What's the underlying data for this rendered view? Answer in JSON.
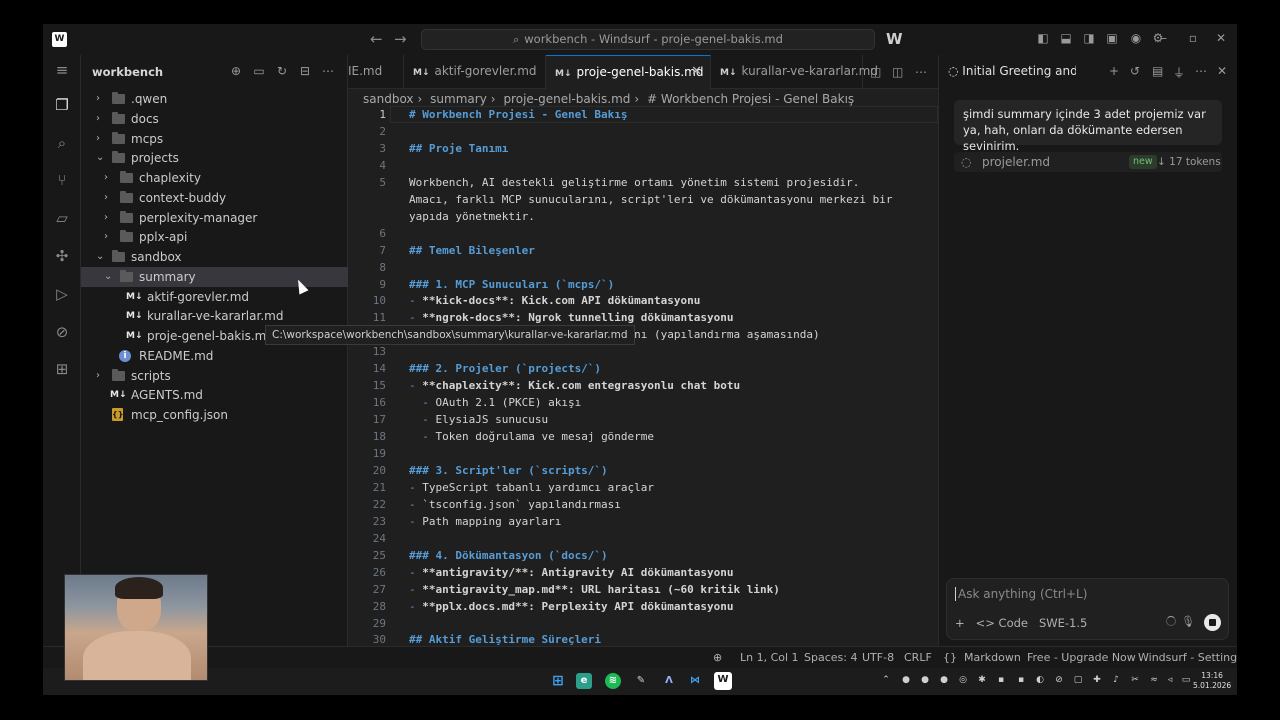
{
  "window": {
    "title": "workbench - Windsurf - proje-genel-bakis.md"
  },
  "sidebar": {
    "title": "workbench",
    "tree": [
      {
        "label": ".qwen",
        "kind": "folder",
        "state": "collapsed",
        "depth": 0
      },
      {
        "label": "docs",
        "kind": "folder",
        "state": "collapsed",
        "depth": 0
      },
      {
        "label": "mcps",
        "kind": "folder",
        "state": "collapsed",
        "depth": 0
      },
      {
        "label": "projects",
        "kind": "folder",
        "state": "expanded",
        "depth": 0
      },
      {
        "label": "chaplexity",
        "kind": "folder",
        "state": "collapsed",
        "depth": 1
      },
      {
        "label": "context-buddy",
        "kind": "folder",
        "state": "collapsed",
        "depth": 1
      },
      {
        "label": "perplexity-manager",
        "kind": "folder",
        "state": "collapsed",
        "depth": 1
      },
      {
        "label": "pplx-api",
        "kind": "folder",
        "state": "collapsed",
        "depth": 1
      },
      {
        "label": "sandbox",
        "kind": "folder",
        "state": "expanded",
        "depth": 0
      },
      {
        "label": "summary",
        "kind": "folder",
        "state": "expanded",
        "depth": 1
      },
      {
        "label": "aktif-gorevler.md",
        "kind": "md",
        "depth": 2
      },
      {
        "label": "kurallar-ve-kararlar.md",
        "kind": "md",
        "depth": 2
      },
      {
        "label": "proje-genel-bakis.md",
        "kind": "md",
        "depth": 2
      },
      {
        "label": "README.md",
        "kind": "info",
        "depth": 1
      },
      {
        "label": "scripts",
        "kind": "folder",
        "state": "collapsed",
        "depth": 0
      },
      {
        "label": "AGENTS.md",
        "kind": "md",
        "depth": 0
      },
      {
        "label": "mcp_config.json",
        "kind": "json",
        "depth": 0
      }
    ],
    "tooltip": "C:\\workspace\\workbench\\sandbox\\summary\\kurallar-ve-kararlar.md"
  },
  "editor": {
    "tabs": [
      {
        "label": "IE.md",
        "active": false
      },
      {
        "label": "aktif-gorevler.md",
        "active": false
      },
      {
        "label": "proje-genel-bakis.md",
        "active": true
      },
      {
        "label": "kurallar-ve-kararlar.md",
        "active": false
      }
    ],
    "breadcrumb": [
      "sandbox",
      "summary",
      "proje-genel-bakis.md",
      "# Workbench Projesi - Genel Bakış"
    ],
    "lines": [
      {
        "n": "1",
        "t": "# Workbench Projesi - Genel Bakış",
        "s": "h"
      },
      {
        "n": "2",
        "t": "",
        "s": ""
      },
      {
        "n": "3",
        "t": "## Proje Tanımı",
        "s": "h"
      },
      {
        "n": "4",
        "t": "",
        "s": ""
      },
      {
        "n": "5",
        "t": "Workbench, AI destekli geliştirme ortamı yönetim sistemi projesidir.",
        "s": ""
      },
      {
        "n": "",
        "t": "Amacı, farklı MCP sunucularını, script'leri ve dökümantasyonu merkezi bir",
        "s": ""
      },
      {
        "n": "",
        "t": "yapıda yönetmektir.",
        "s": ""
      },
      {
        "n": "6",
        "t": "",
        "s": ""
      },
      {
        "n": "7",
        "t": "## Temel Bileşenler",
        "s": "h"
      },
      {
        "n": "8",
        "t": "",
        "s": ""
      },
      {
        "n": "9",
        "t": "### 1. MCP Sunucuları (`mcps/`)",
        "s": "h"
      },
      {
        "n": "10",
        "t": "- **kick-docs**: Kick.com API dökümantasyonu",
        "s": "li"
      },
      {
        "n": "11",
        "t": "- **ngrok-docs**: Ngrok tunnelling dökümantasyonu",
        "s": "li"
      },
      {
        "n": "12",
        "t": "                                manı (yapılandırma aşamasında)",
        "s": ""
      },
      {
        "n": "13",
        "t": "",
        "s": ""
      },
      {
        "n": "14",
        "t": "### 2. Projeler (`projects/`)",
        "s": "h"
      },
      {
        "n": "15",
        "t": "- **chaplexity**: Kick.com entegrasyonlu chat botu",
        "s": "li"
      },
      {
        "n": "16",
        "t": "  - OAuth 2.1 (PKCE) akışı",
        "s": "li"
      },
      {
        "n": "17",
        "t": "  - ElysiaJS sunucusu",
        "s": "li"
      },
      {
        "n": "18",
        "t": "  - Token doğrulama ve mesaj gönderme",
        "s": "li"
      },
      {
        "n": "19",
        "t": "",
        "s": ""
      },
      {
        "n": "20",
        "t": "### 3. Script'ler (`scripts/`)",
        "s": "h"
      },
      {
        "n": "21",
        "t": "- TypeScript tabanlı yardımcı araçlar",
        "s": "li"
      },
      {
        "n": "22",
        "t": "- `tsconfig.json` yapılandırması",
        "s": "li"
      },
      {
        "n": "23",
        "t": "- Path mapping ayarları",
        "s": "li"
      },
      {
        "n": "24",
        "t": "",
        "s": ""
      },
      {
        "n": "25",
        "t": "### 4. Dökümantasyon (`docs/`)",
        "s": "h"
      },
      {
        "n": "26",
        "t": "- **antigravity/**: Antigravity AI dökümantasyonu",
        "s": "li"
      },
      {
        "n": "27",
        "t": "- **antigravity_map.md**: URL haritası (~60 kritik link)",
        "s": "li"
      },
      {
        "n": "28",
        "t": "- **pplx.docs.md**: Perplexity API dökümantasyonu",
        "s": "li"
      },
      {
        "n": "29",
        "t": "",
        "s": ""
      },
      {
        "n": "30",
        "t": "## Aktif Geliştirme Süreçleri",
        "s": "h"
      }
    ]
  },
  "chat": {
    "tab_title": "Initial Greeting and C",
    "user_message": "şimdi summary içinde 3 adet projemiz var ya, hah, onları da dökümante edersen sevinirim.",
    "file_item": {
      "name": "projeler.md",
      "badge": "new",
      "tokens": "↓ 17 tokens"
    },
    "input_placeholder": "Ask anything (Ctrl+L)",
    "code_label": "Code",
    "model": "SWE-1.5"
  },
  "statusbar": {
    "position": "Ln 1, Col 1",
    "spaces": "Spaces: 4",
    "encoding": "UTF-8",
    "eol": "CRLF",
    "language": "Markdown",
    "upgrade": "Free - Upgrade Now",
    "settings": "Windsurf - Settings"
  },
  "taskbar": {
    "time": "13:16",
    "date": "5.01.2026"
  },
  "colors": {
    "accent": "#0078d4",
    "heading": "#569cd6",
    "bg": "#1f1f1f",
    "badge_green": "#6fbf73"
  }
}
